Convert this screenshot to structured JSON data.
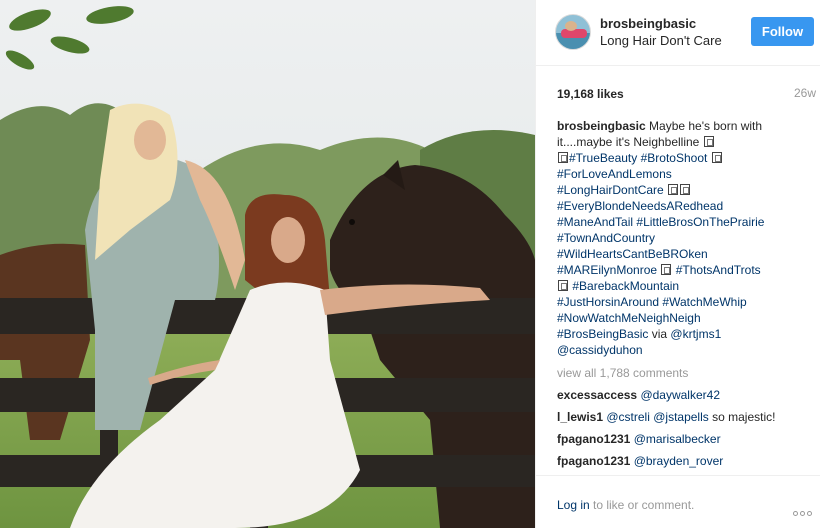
{
  "post": {
    "username": "brosbeingbasic",
    "location": "Long Hair Don't Care",
    "follow_label": "Follow",
    "likes": "19,168 likes",
    "age": "26w"
  },
  "caption": {
    "user": "brosbeingbasic",
    "intro": "Maybe he's born with it....maybe it's Neighbelline",
    "hashtags": [
      "#TrueBeauty",
      "#BrotoShoot",
      "#ForLoveAndLemons",
      "#LongHairDontCare",
      "#EveryBlondeNeedsARedhead",
      "#ManeAndTail",
      "#LittleBrosOnThePrairie",
      "#TownAndCountry",
      "#WildHeartsCantBeBROken",
      "#MAREilynMonroe",
      "#ThotsAndTrots",
      "#BarebackMountain",
      "#JustHorsinAround",
      "#WatchMeWhip",
      "#NowWatchMeNeighNeigh",
      "#BrosBeingBasic"
    ],
    "via_word": "via",
    "mention1": "@krtjms1",
    "mention2": "@cassidyduhon"
  },
  "view_all_comments": "view all 1,788 comments",
  "comments": [
    {
      "user": "excessaccess",
      "mentions": "@daywalker42",
      "text": ""
    },
    {
      "user": "l_lewis1",
      "mentions": "@cstreli @jstapells",
      "text": "so majestic!"
    },
    {
      "user": "fpagano1231",
      "mentions": "@marisalbecker",
      "text": ""
    },
    {
      "user": "fpagano1231",
      "mentions": "@brayden_rover",
      "text": ""
    }
  ],
  "footer": {
    "login_link": "Log in",
    "login_rest": "to like or comment."
  },
  "icons": {
    "more": "more-options-icon"
  },
  "colors": {
    "follow_button": "#3897f0",
    "link": "#003569",
    "muted": "#999999"
  }
}
